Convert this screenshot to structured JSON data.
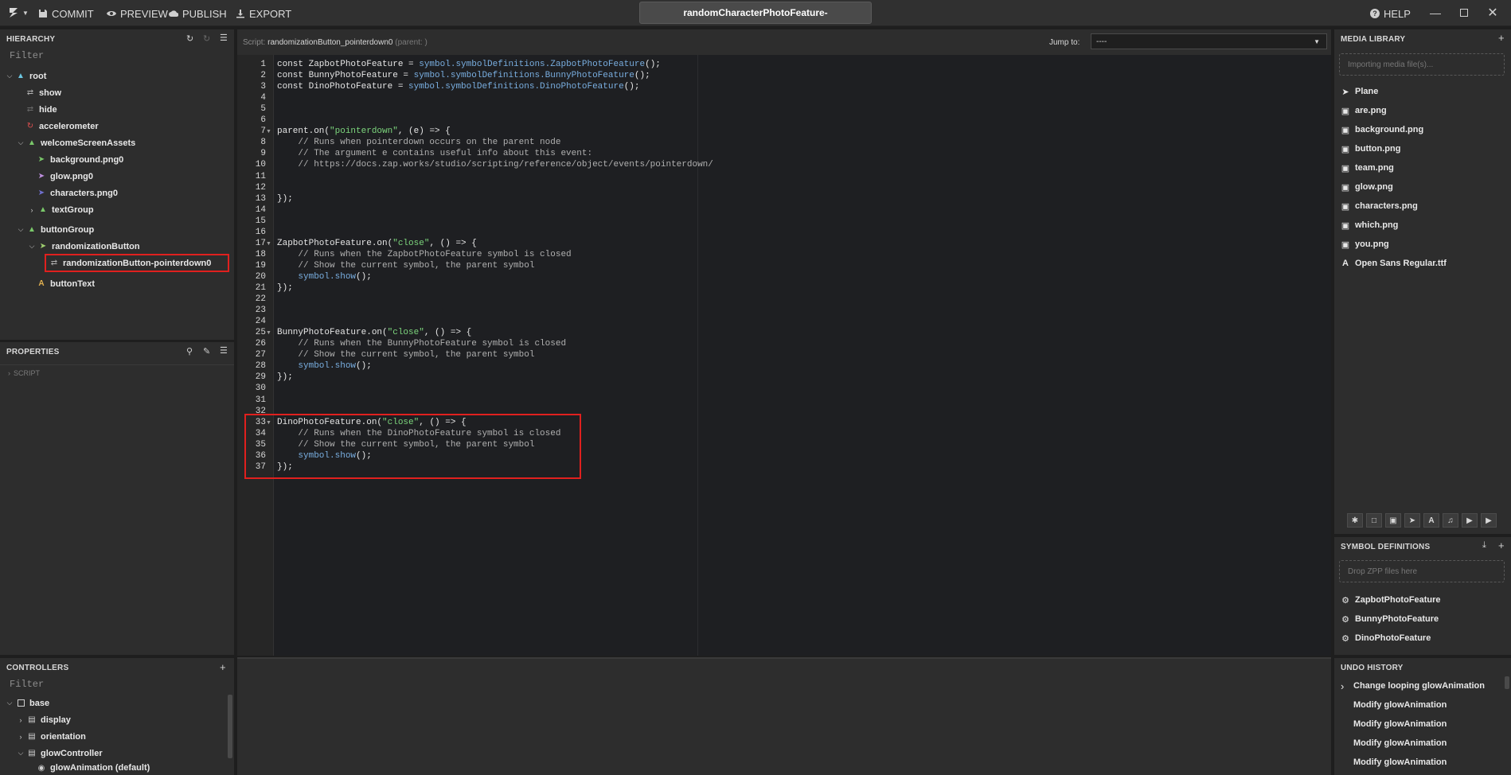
{
  "toolbar": {
    "commit": "COMMIT",
    "preview": "PREVIEW",
    "publish": "PUBLISH",
    "export": "EXPORT",
    "help": "HELP",
    "project_title": "randomCharacterPhotoFeature-"
  },
  "hierarchy": {
    "title": "HIERARCHY",
    "filter_placeholder": "Filter",
    "items": [
      {
        "label": "root",
        "icon": "group-icon"
      },
      {
        "label": "show",
        "icon": "shuffle-icon"
      },
      {
        "label": "hide",
        "icon": "shuffle-icon"
      },
      {
        "label": "accelerometer",
        "icon": "accelerometer-icon"
      },
      {
        "label": "welcomeScreenAssets",
        "icon": "group-icon"
      },
      {
        "label": "background.png0",
        "icon": "plane-icon"
      },
      {
        "label": "glow.png0",
        "icon": "plane-icon"
      },
      {
        "label": "characters.png0",
        "icon": "plane-icon"
      },
      {
        "label": "textGroup",
        "icon": "group-icon"
      },
      {
        "label": "buttonGroup",
        "icon": "group-icon"
      },
      {
        "label": "randomizationButton",
        "icon": "plane-icon"
      },
      {
        "label": "randomizationButton-pointerdown0",
        "icon": "script-icon"
      },
      {
        "label": "buttonText",
        "icon": "text-icon"
      }
    ]
  },
  "properties": {
    "title": "PROPERTIES",
    "section": "SCRIPT"
  },
  "controllers": {
    "title": "CONTROLLERS",
    "filter_placeholder": "Filter",
    "items": [
      {
        "label": "base"
      },
      {
        "label": "display"
      },
      {
        "label": "orientation"
      },
      {
        "label": "glowController"
      },
      {
        "label": "glowAnimation (default)"
      }
    ]
  },
  "editor": {
    "script_prefix": "Script:",
    "script_name": "randomizationButton_pointerdown0",
    "script_parent": "(parent: )",
    "jump_to_label": "Jump to:",
    "jump_to_value": "----"
  },
  "code_lines": [
    "const ZapbotPhotoFeature = symbol.symbolDefinitions.ZapbotPhotoFeature();",
    "const BunnyPhotoFeature = symbol.symbolDefinitions.BunnyPhotoFeature();",
    "const DinoPhotoFeature = symbol.symbolDefinitions.DinoPhotoFeature();",
    "",
    "",
    "",
    "parent.on(\"pointerdown\", (e) => {",
    "    // Runs when pointerdown occurs on the parent node",
    "    // The argument e contains useful info about this event:",
    "    // https://docs.zap.works/studio/scripting/reference/object/events/pointerdown/",
    "",
    "",
    "});",
    "",
    "",
    "",
    "ZapbotPhotoFeature.on(\"close\", () => {",
    "    // Runs when the ZapbotPhotoFeature symbol is closed",
    "    // Show the current symbol, the parent symbol",
    "    symbol.show();",
    "});",
    "",
    "",
    "",
    "BunnyPhotoFeature.on(\"close\", () => {",
    "    // Runs when the BunnyPhotoFeature symbol is closed",
    "    // Show the current symbol, the parent symbol",
    "    symbol.show();",
    "});",
    "",
    "",
    "",
    "DinoPhotoFeature.on(\"close\", () => {",
    "    // Runs when the DinoPhotoFeature symbol is closed",
    "    // Show the current symbol, the parent symbol",
    "    symbol.show();",
    "});"
  ],
  "media_library": {
    "title": "MEDIA LIBRARY",
    "dropzone": "Importing media file(s)...",
    "items": [
      {
        "label": "Plane",
        "icon": "plane-icon"
      },
      {
        "label": "are.png",
        "icon": "image-icon"
      },
      {
        "label": "background.png",
        "icon": "image-icon"
      },
      {
        "label": "button.png",
        "icon": "image-icon"
      },
      {
        "label": "team.png",
        "icon": "image-icon"
      },
      {
        "label": "glow.png",
        "icon": "image-icon"
      },
      {
        "label": "characters.png",
        "icon": "image-icon"
      },
      {
        "label": "which.png",
        "icon": "image-icon"
      },
      {
        "label": "you.png",
        "icon": "image-icon"
      },
      {
        "label": "Open Sans Regular.ttf",
        "icon": "font-icon"
      }
    ]
  },
  "symbol_definitions": {
    "title": "SYMBOL DEFINITIONS",
    "dropzone": "Drop ZPP files here",
    "items": [
      {
        "label": "ZapbotPhotoFeature"
      },
      {
        "label": "BunnyPhotoFeature"
      },
      {
        "label": "DinoPhotoFeature"
      }
    ]
  },
  "undo_history": {
    "title": "UNDO HISTORY",
    "items": [
      {
        "label": "Change looping glowAnimation"
      },
      {
        "label": "Modify glowAnimation"
      },
      {
        "label": "Modify glowAnimation"
      },
      {
        "label": "Modify glowAnimation"
      },
      {
        "label": "Modify glowAnimation"
      }
    ]
  },
  "colors": {
    "highlight": "#e0201e",
    "code_string": "#7dd67d",
    "code_identifier": "#79aee0",
    "code_comment": "#b0b0b0"
  }
}
